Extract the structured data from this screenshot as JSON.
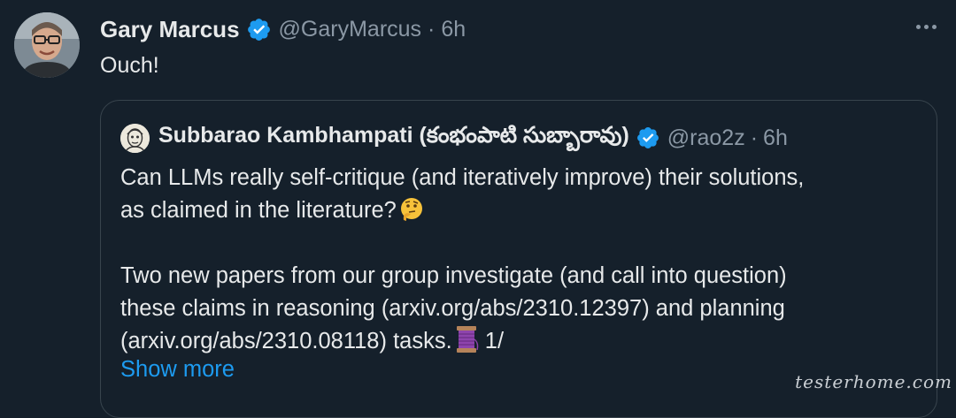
{
  "tweet": {
    "author_name": "Gary Marcus",
    "author_handle": "@GaryMarcus",
    "separator": "·",
    "time": "6h",
    "text": "Ouch!",
    "avatar_icon": "profile-photo"
  },
  "quoted_tweet": {
    "author_name": "Subbarao Kambhampati (కంభంపాటి సుబ్బారావు)",
    "author_handle": "@rao2z",
    "separator": "·",
    "time": "6h",
    "lines": [
      "Can LLMs really self-critique (and iteratively improve) their solutions,",
      "as claimed in the literature?",
      "Two new papers from our group investigate (and call into question)",
      "these claims in reasoning (arxiv.org/abs/2310.12397) and planning",
      "(arxiv.org/abs/2310.08118) tasks.",
      " 1/"
    ],
    "emojis": [
      "thinking-face-emoji",
      "thread-spool-emoji"
    ],
    "show_more": "Show more"
  },
  "icons": {
    "verified": "verified-badge-icon",
    "more": "more-options-icon"
  },
  "colors": {
    "background": "#15202b",
    "text": "#e7e9ea",
    "muted": "#8b98a5",
    "link": "#1d9bf0",
    "border": "#38444d"
  },
  "watermark": "testerhome.com"
}
